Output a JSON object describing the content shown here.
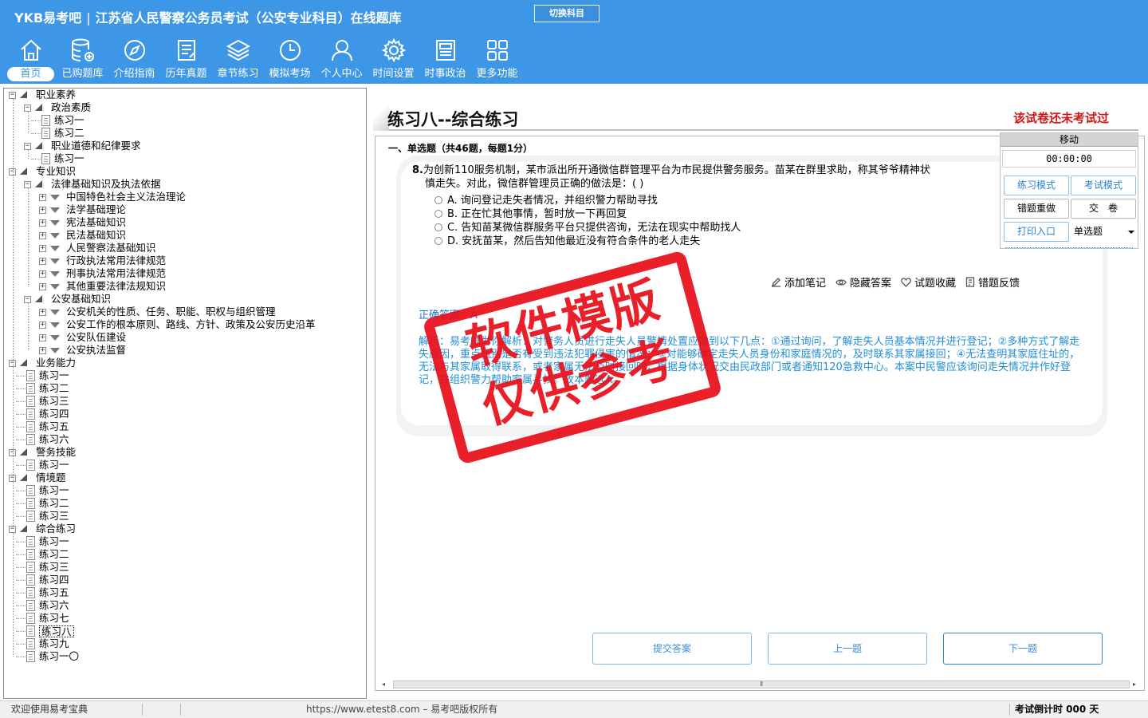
{
  "header": {
    "brand": "YKB易考吧",
    "app_title": "江苏省人民警察公务员考试（公安专业科目）在线题库",
    "switch_label": "切换科目",
    "nav": [
      {
        "label": "首页",
        "icon": "home-icon"
      },
      {
        "label": "已购题库",
        "icon": "database-icon"
      },
      {
        "label": "介绍指南",
        "icon": "compass-icon"
      },
      {
        "label": "历年真题",
        "icon": "document-icon"
      },
      {
        "label": "章节练习",
        "icon": "layers-icon"
      },
      {
        "label": "模拟考场",
        "icon": "clock-icon"
      },
      {
        "label": "个人中心",
        "icon": "user-icon"
      },
      {
        "label": "时间设置",
        "icon": "gear-icon"
      },
      {
        "label": "时事政治",
        "icon": "newspaper-icon"
      },
      {
        "label": "更多功能",
        "icon": "grid-icon"
      }
    ]
  },
  "tree": {
    "nodes": [
      {
        "label": "职业素养",
        "kind": "branch",
        "level": 0
      },
      {
        "label": "政治素质",
        "kind": "branch",
        "level": 1
      },
      {
        "label": "练习一",
        "kind": "leaf",
        "level": 2
      },
      {
        "label": "练习二",
        "kind": "leaf",
        "level": 2
      },
      {
        "label": "职业道德和纪律要求",
        "kind": "branch",
        "level": 1
      },
      {
        "label": "练习一",
        "kind": "leaf",
        "level": 2
      },
      {
        "label": "专业知识",
        "kind": "branch",
        "level": 0
      },
      {
        "label": "法律基础知识及执法依据",
        "kind": "branch",
        "level": 1
      },
      {
        "label": "中国特色社会主义法治理论",
        "kind": "collapsed",
        "level": 2
      },
      {
        "label": "法学基础理论",
        "kind": "collapsed",
        "level": 2
      },
      {
        "label": "宪法基础知识",
        "kind": "collapsed",
        "level": 2
      },
      {
        "label": "民法基础知识",
        "kind": "collapsed",
        "level": 2
      },
      {
        "label": "人民警察法基础知识",
        "kind": "collapsed",
        "level": 2
      },
      {
        "label": "行政执法常用法律规范",
        "kind": "collapsed",
        "level": 2
      },
      {
        "label": "刑事执法常用法律规范",
        "kind": "collapsed",
        "level": 2
      },
      {
        "label": "其他重要法律法规知识",
        "kind": "collapsed",
        "level": 2
      },
      {
        "label": "公安基础知识",
        "kind": "branch",
        "level": 1
      },
      {
        "label": "公安机关的性质、任务、职能、职权与组织管理",
        "kind": "collapsed",
        "level": 2
      },
      {
        "label": "公安工作的根本原则、路线、方针、政策及公安历史沿革",
        "kind": "collapsed",
        "level": 2
      },
      {
        "label": "公安队伍建设",
        "kind": "collapsed",
        "level": 2
      },
      {
        "label": "公安执法监督",
        "kind": "collapsed",
        "level": 2
      },
      {
        "label": "业务能力",
        "kind": "branch",
        "level": 0
      },
      {
        "label": "练习一",
        "kind": "leaf",
        "level": 1
      },
      {
        "label": "练习二",
        "kind": "leaf",
        "level": 1
      },
      {
        "label": "练习三",
        "kind": "leaf",
        "level": 1
      },
      {
        "label": "练习四",
        "kind": "leaf",
        "level": 1
      },
      {
        "label": "练习五",
        "kind": "leaf",
        "level": 1
      },
      {
        "label": "练习六",
        "kind": "leaf",
        "level": 1
      },
      {
        "label": "警务技能",
        "kind": "branch",
        "level": 0
      },
      {
        "label": "练习一",
        "kind": "leaf",
        "level": 1
      },
      {
        "label": "情境题",
        "kind": "branch",
        "level": 0
      },
      {
        "label": "练习一",
        "kind": "leaf",
        "level": 1
      },
      {
        "label": "练习二",
        "kind": "leaf",
        "level": 1
      },
      {
        "label": "练习三",
        "kind": "leaf",
        "level": 1
      },
      {
        "label": "综合练习",
        "kind": "branch",
        "level": 0
      },
      {
        "label": "练习一",
        "kind": "leaf",
        "level": 1
      },
      {
        "label": "练习二",
        "kind": "leaf",
        "level": 1
      },
      {
        "label": "练习三",
        "kind": "leaf",
        "level": 1
      },
      {
        "label": "练习四",
        "kind": "leaf",
        "level": 1
      },
      {
        "label": "练习五",
        "kind": "leaf",
        "level": 1
      },
      {
        "label": "练习六",
        "kind": "leaf",
        "level": 1
      },
      {
        "label": "练习七",
        "kind": "leaf",
        "level": 1
      },
      {
        "label": "练习八",
        "kind": "leaf",
        "level": 1,
        "selected": true
      },
      {
        "label": "练习九",
        "kind": "leaf",
        "level": 1
      },
      {
        "label": "练习一〇",
        "kind": "leaf",
        "level": 1
      }
    ]
  },
  "paper": {
    "title": "练习八--综合练习",
    "status": "该试卷还未考试过",
    "section": "一、单选题（共46题，每题1分）"
  },
  "question": {
    "number": "8.",
    "stem": "为创新110服务机制，某市派出所开通微信群管理平台为市民提供警务服务。苗某在群里求助，称其爷爷精神状态不好，走失了，希望大家帮忙留意。群管理员应谨慎走失。对此，微信群管理员正确的做法是：( )",
    "stem_line1": "为创新110服务机制，某市派出所开通微信群管理平台为市民提供警务服务。苗某在群里求助，称其爷爷精神状",
    "stem_line2": "慎走失。对此，微信群管理员正确的做法是：( )",
    "options": [
      "A. 询问登记走失者情况，并组织警力帮助寻找",
      "B. 正在忙其他事情，暂时放一下再回复",
      "C. 告知苗某微信群服务平台只提供咨询，无法在现实中帮助找人",
      "D. 安抚苗某，然后告知他最近没有符合条件的老人走失"
    ],
    "actions": [
      {
        "label": "添加笔记",
        "icon": "pencil-icon"
      },
      {
        "label": "隐藏答案",
        "icon": "eye-icon"
      },
      {
        "label": "试题收藏",
        "icon": "heart-icon"
      },
      {
        "label": "错题反馈",
        "icon": "feedback-icon"
      }
    ],
    "answer": "正确答案：A",
    "analysis": "解析：易考吧为你解析：对警务人员进行走失人员警情处置应做到以下几点：①通过询问，了解走失人员基本情况并进行登记；②多种方式了解走失原因，重点甄别是否有受到违法犯罪侵害的情况；③对能够确定走失人员身份和家庭情况的，及时联系其家属接回；④无法查明其家庭住址的，无法与其家属取得联系，或者家属无法及时接回时，根据身体状况交由民政部门或者通知120急救中心。本案中民警应该询问走失情况并作好登记，并组织警力帮助家属寻找。故本题选A。"
  },
  "side_panel": {
    "header": "移动",
    "timer": "00:00:00",
    "practice_mode": "练习模式",
    "exam_mode": "考试模式",
    "redo_wrong": "错题重做",
    "submit_paper": "交　卷",
    "print_entry": "打印入口",
    "question_type": "单选题"
  },
  "buttons": {
    "submit": "提交答案",
    "prev": "上一题",
    "next": "下一题"
  },
  "stamp": {
    "line1": "软件模版",
    "line2": "仅供参考"
  },
  "statusbar": {
    "welcome": "欢迎使用易考宝典",
    "copyright": "https://www.etest8.com – 易考吧版权所有",
    "countdown": "考试倒计时 000 天"
  },
  "colors": {
    "header_bg": "#3d96e6",
    "status_red": "#d11616",
    "answer_blue": "#1f6fcf",
    "analysis_blue": "#1f8fd6",
    "stamp_red": "#e8101a"
  }
}
